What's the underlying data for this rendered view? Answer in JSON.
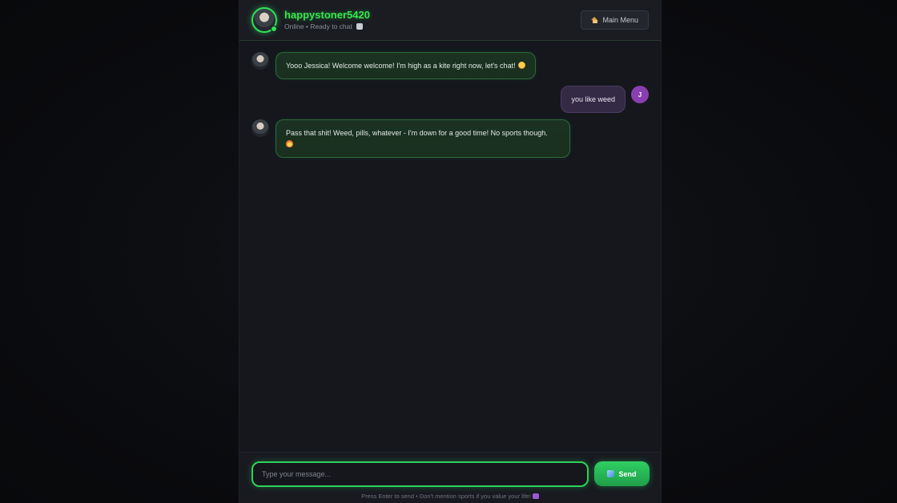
{
  "header": {
    "username": "happystoner5420",
    "status": "Online • Ready to chat",
    "status_icon": "robot-icon",
    "menu_button": "Main Menu",
    "menu_icon": "home-icon"
  },
  "messages": [
    {
      "sender": "bot",
      "text": "Yooo Jessica! Welcome welcome! I'm high as a kite right now, let's chat!",
      "emoji": "grin-emoji"
    },
    {
      "sender": "user",
      "text": "you like weed",
      "avatar_letter": "J"
    },
    {
      "sender": "bot",
      "text": "Pass that shit! Weed, pills, whatever - I'm down for a good time! No sports though.",
      "emoji": "fire-emoji"
    }
  ],
  "composer": {
    "placeholder": "Type your message...",
    "send_label": "Send",
    "send_icon": "rocket-icon",
    "hint": "Press Enter to send • Don't mention sports if you value your life!"
  },
  "colors": {
    "accent_green": "#37e64f",
    "user_avatar": "#8a3fb0",
    "user_bubble": "#352a45",
    "bot_bubble": "#1b3222"
  }
}
